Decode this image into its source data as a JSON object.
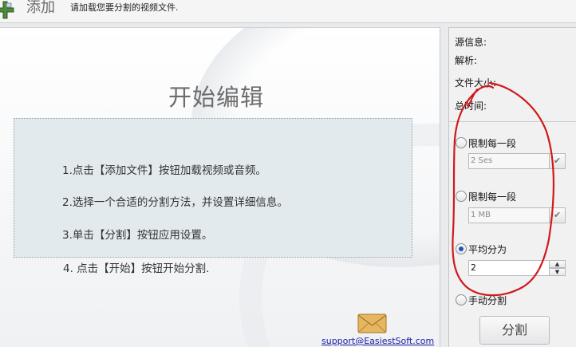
{
  "toolbar": {
    "add_label": "添加",
    "hint": "请加载您要分割的视频文件."
  },
  "main": {
    "title": "开始编辑",
    "steps": [
      "1.点击【添加文件】按钮加载视频或音频。",
      "2.选择一个合适的分割方法，并设置详细信息。",
      "3.单击【分割】按钮应用设置。",
      "4. 点击【开始】按钮开始分割."
    ],
    "support_link": "support@EasiestSoft.com"
  },
  "side": {
    "info": {
      "source": "源信息:",
      "parse": "解析:",
      "file_size": "文件大小:",
      "total_time": "总时间:"
    },
    "options": [
      {
        "label": "限制每一段",
        "value": "2 Ses",
        "selected": false
      },
      {
        "label": "限制每一段",
        "value": "1 MB",
        "selected": false
      },
      {
        "label": "平均分为",
        "value": "2",
        "selected": true
      },
      {
        "label": "手动分割",
        "selected": false
      }
    ],
    "split_button": "分割"
  },
  "colors": {
    "annotation": "#d0191e",
    "link": "#1a1aa8",
    "steps_bg": "#e3eaed"
  }
}
